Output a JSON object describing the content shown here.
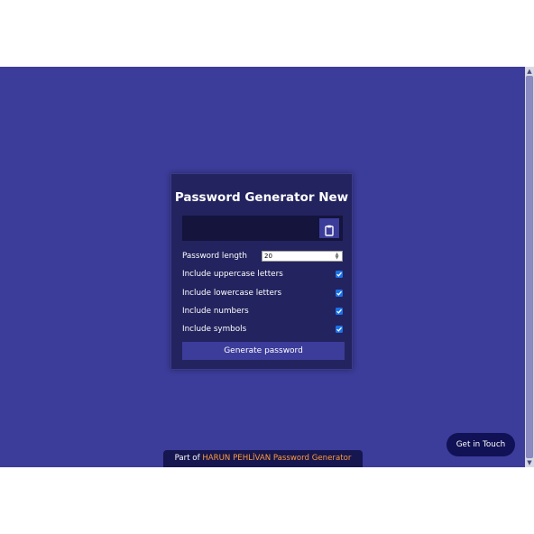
{
  "app": {
    "title": "Password Generator New"
  },
  "result": {
    "value": ""
  },
  "options": {
    "length_label": "Password length",
    "length_value": "20",
    "uppercase_label": "Include uppercase letters",
    "uppercase_checked": true,
    "lowercase_label": "Include lowercase letters",
    "lowercase_checked": true,
    "numbers_label": "Include numbers",
    "numbers_checked": true,
    "symbols_label": "Include symbols",
    "symbols_checked": true
  },
  "actions": {
    "generate_label": "Generate password",
    "contact_label": "Get in Touch"
  },
  "footer": {
    "prefix": "Part of ",
    "link_text": "HARUN PEHLİVAN Password Generator"
  },
  "icons": {
    "copy": "clipboard-icon",
    "checkbox": "check-icon"
  },
  "colors": {
    "page_bg": "#3c3c9a",
    "card_bg": "#23235f",
    "accent": "#ff9a3c",
    "checkbox": "#1a73e8"
  }
}
